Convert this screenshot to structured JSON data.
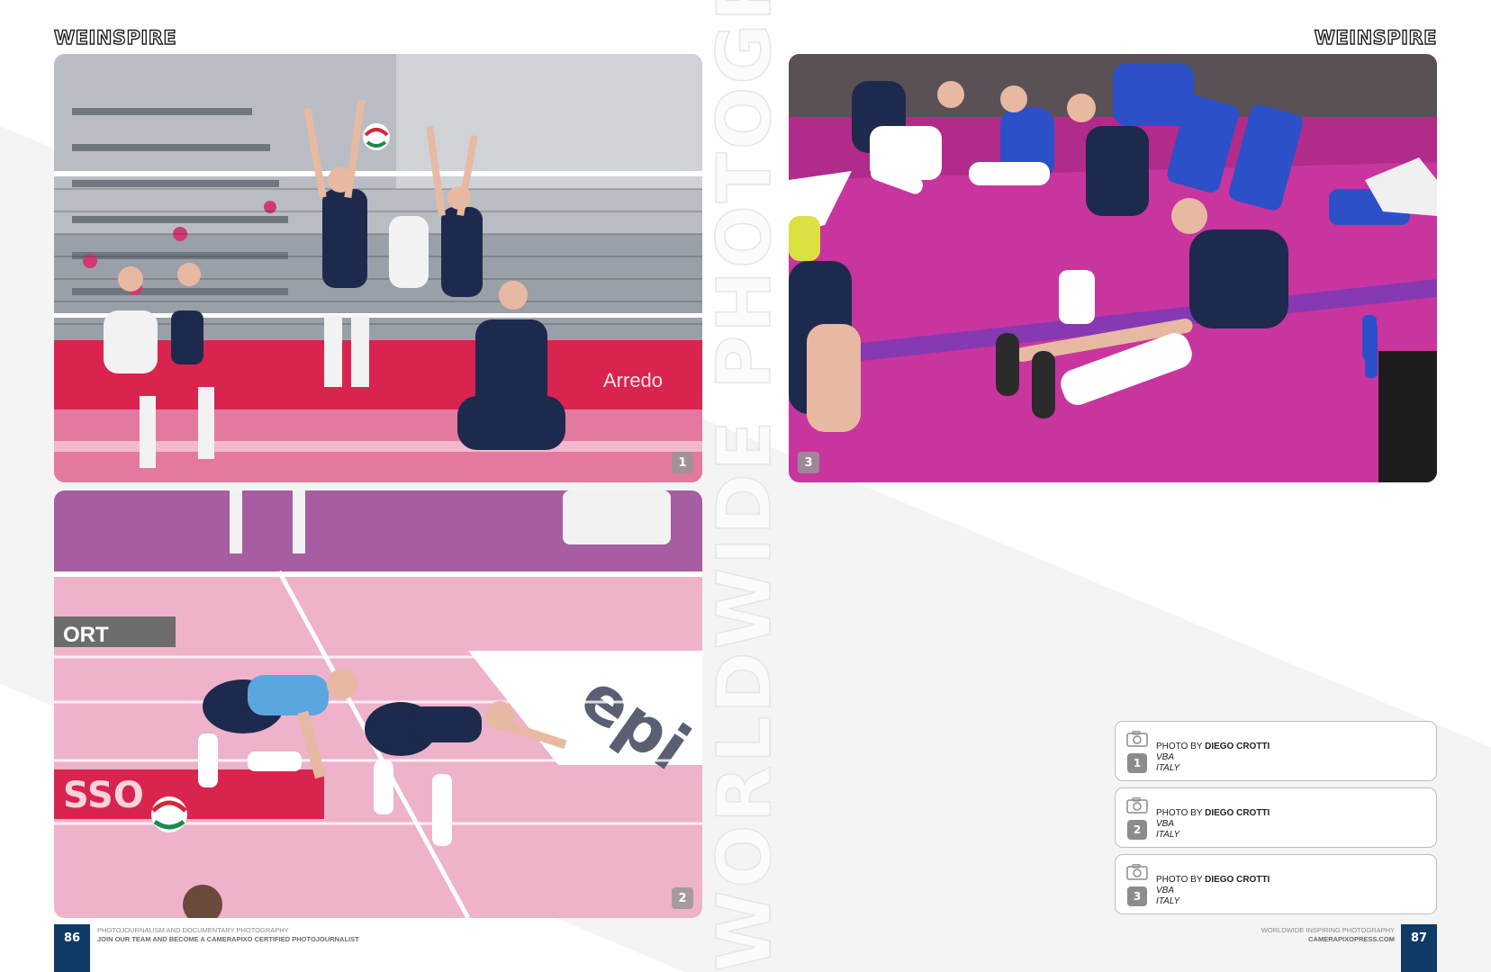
{
  "spine": {
    "text": "WORLDWIDE PHOTOGRAPHY"
  },
  "brand": {
    "logo_left": "WEINSPIRE",
    "logo_right": "WEINSPIRE"
  },
  "photos": [
    {
      "number": "1",
      "subject": "volleyball block at the net"
    },
    {
      "number": "2",
      "subject": "players diving for the ball"
    },
    {
      "number": "3",
      "subject": "players stretching on court"
    }
  ],
  "credits": [
    {
      "number": "1",
      "prefix": "PHOTO BY",
      "photographer": "DIEGO CROTTI",
      "line2": "VBA",
      "line3": "ITALY"
    },
    {
      "number": "2",
      "prefix": "PHOTO BY",
      "photographer": "DIEGO CROTTI",
      "line2": "VBA",
      "line3": "ITALY"
    },
    {
      "number": "3",
      "prefix": "PHOTO BY",
      "photographer": "DIEGO CROTTI",
      "line2": "VBA",
      "line3": "ITALY"
    }
  ],
  "footer": {
    "left_page": "86",
    "left_line1": "PHOTOJOURNALISM AND DOCUMENTARY PHOTOGRAPHY",
    "left_line2": "JOIN OUR TEAM AND BECOME A CAMERAPIXO CERTIFIED PHOTOJOURNALIST",
    "right_page": "87",
    "right_line1": "WORLDWIDE INSPIRING PHOTOGRAPHY",
    "right_line2": "CAMERAPIXOPRESS.COM"
  },
  "colors": {
    "folio": "#0f3b66",
    "court_pink": "#e1689a",
    "court_magenta": "#c9359e",
    "jersey_navy": "#1e2a4d"
  }
}
